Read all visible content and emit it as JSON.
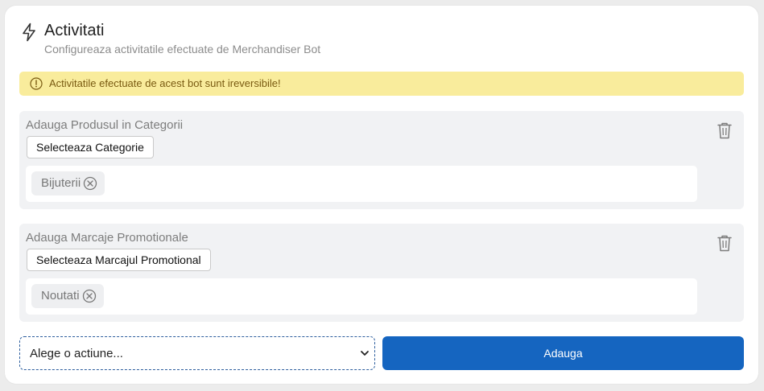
{
  "header": {
    "title": "Activitati",
    "subtitle": "Configureaza activitatile efectuate de Merchandiser Bot",
    "icon": "lightning-icon"
  },
  "alert": {
    "text": "Activitatile efectuate de acest bot sunt ireversibile!",
    "icon": "info-icon",
    "bg_color": "#f9ec9c",
    "text_color": "#7a5b12"
  },
  "sections": [
    {
      "title": "Adauga Produsul in Categorii",
      "button_label": "Selecteaza Categorie",
      "tags": [
        {
          "label": "Bijuterii"
        }
      ]
    },
    {
      "title": "Adauga Marcaje Promotionale",
      "button_label": "Selecteaza Marcajul Promotional",
      "tags": [
        {
          "label": "Noutati"
        }
      ]
    }
  ],
  "footer": {
    "select_value": "Alege o actiune...",
    "add_label": "Adauga",
    "accent_color": "#1565c0"
  }
}
